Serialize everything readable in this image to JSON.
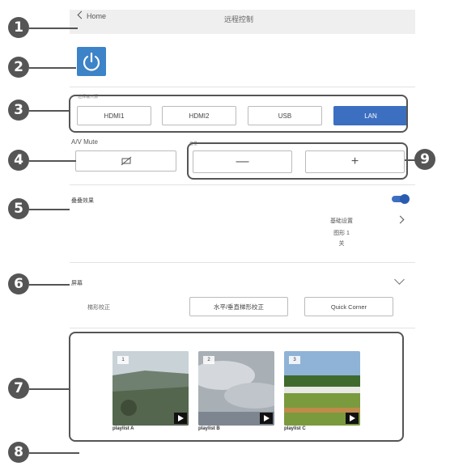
{
  "header": {
    "back_label": "Home",
    "title": "远程控制"
  },
  "source": {
    "label": "选择输入源",
    "buttons": [
      {
        "label": "HDMI1",
        "active": false
      },
      {
        "label": "HDMI2",
        "active": false
      },
      {
        "label": "USB",
        "active": false
      },
      {
        "label": "LAN",
        "active": true
      }
    ]
  },
  "av_mute": {
    "label": "A/V Mute"
  },
  "volume": {
    "label": "音量",
    "minus": "—",
    "plus": "+"
  },
  "overlay": {
    "label": "叠叠效果",
    "enabled": true,
    "info_lines": [
      "基础设置",
      "图形 1",
      "关"
    ]
  },
  "screen": {
    "label": "屏幕",
    "keystone_label": "梯形校正",
    "hv_button": "水平/垂直梯形校正",
    "quick_corner": "Quick Corner"
  },
  "playlists": [
    {
      "number": "1",
      "name": "playlist A"
    },
    {
      "number": "2",
      "name": "playlist B"
    },
    {
      "number": "3",
      "name": "playlist C"
    }
  ],
  "callouts": [
    "1",
    "2",
    "3",
    "4",
    "5",
    "6",
    "7",
    "8",
    "9"
  ],
  "colors": {
    "accent": "#3d6fc1",
    "power": "#3c83c8",
    "callout": "#555555"
  }
}
